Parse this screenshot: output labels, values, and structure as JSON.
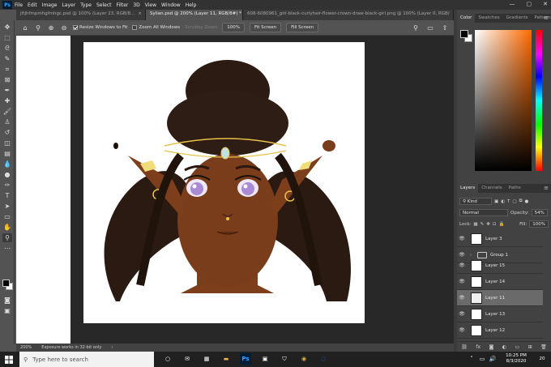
{
  "menubar": {
    "items": [
      "File",
      "Edit",
      "Image",
      "Layer",
      "Type",
      "Select",
      "Filter",
      "3D",
      "View",
      "Window",
      "Help"
    ],
    "window_controls": [
      "—",
      "▢",
      "✕"
    ]
  },
  "tabs": [
    {
      "label": "jftjhfmpmhgfmhgc.psd @ 100% (Layer 23, RGB/8...",
      "close": "×"
    },
    {
      "label": "Sylian.psd @ 200% (Layer 11, RGB/8#) *",
      "close": "×"
    },
    {
      "label": "608-6080961_girl-black-curlyhair-flower-crown-draw-black-girl.png @ 100% (Layer 0, RGB/",
      "close": "»"
    }
  ],
  "options": {
    "resize_windows": "Resize Windows to Fit",
    "zoom_all": "Zoom All Windows",
    "scrubby_zoom": "Scrubby Zoom",
    "zoom_value": "100%",
    "fit_screen": "Fit Screen",
    "fill_screen": "Fill Screen"
  },
  "status": {
    "zoom": "200%",
    "message": "Exposure works in 32-bit only"
  },
  "color_panel": {
    "tabs": [
      "Color",
      "Swatches",
      "Gradients",
      "Patterns"
    ]
  },
  "layers_panel": {
    "tabs": [
      "Layers",
      "Channels",
      "Paths"
    ],
    "filter": "Kind",
    "blend_mode": "Normal",
    "opacity_label": "Opacity:",
    "opacity": "54%",
    "lock_label": "Lock:",
    "fill_label": "Fill:",
    "fill": "100%",
    "layers": [
      {
        "name": "Layer 3",
        "type": "layer",
        "selected": false
      },
      {
        "name": "Group 1",
        "type": "group",
        "selected": false
      },
      {
        "name": "Layer 15",
        "type": "layer",
        "selected": false
      },
      {
        "name": "Layer 14",
        "type": "layer",
        "selected": false
      },
      {
        "name": "Layer 11",
        "type": "layer",
        "selected": true
      },
      {
        "name": "Layer 13",
        "type": "layer",
        "selected": false
      },
      {
        "name": "Layer 12",
        "type": "layer",
        "selected": false
      }
    ],
    "footer_icons": [
      "link-icon",
      "fx-icon",
      "mask-icon",
      "adjustment-icon",
      "folder-icon",
      "new-layer-icon",
      "trash-icon"
    ],
    "footer_text": "fx"
  },
  "taskbar": {
    "search_placeholder": "Type here to search",
    "time": "10:25 PM",
    "date": "8/3/2020",
    "notifications": "20"
  },
  "colors": {
    "ps_blue": "#31a8ff",
    "skin": "#7a3d1c",
    "hair": "#2a1a12"
  }
}
